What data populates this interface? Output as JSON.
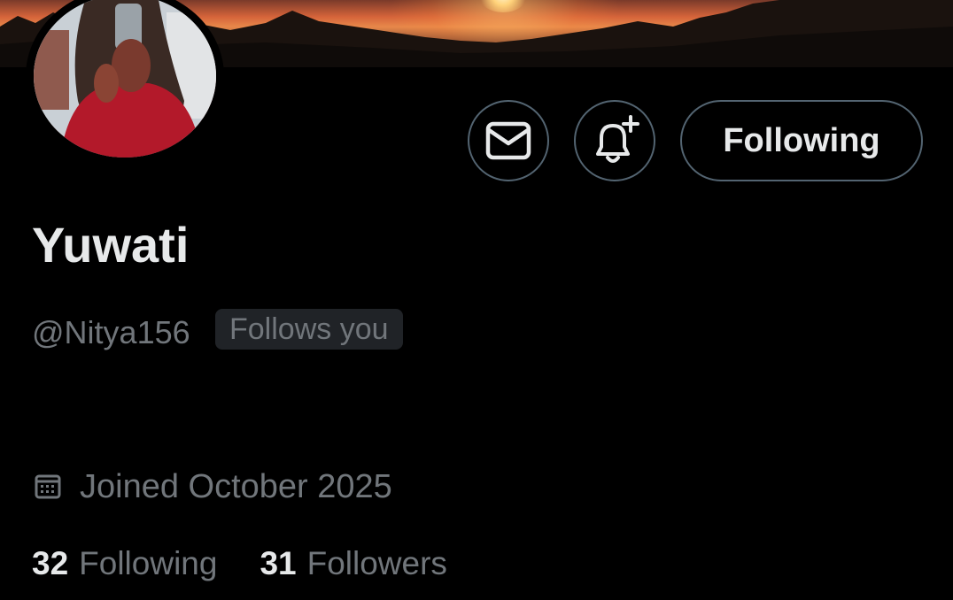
{
  "profile": {
    "display_name": "Yuwati",
    "handle": "@Nitya156",
    "follows_you_badge": "Follows you",
    "joined": "Joined October 2025"
  },
  "actions": {
    "follow_state_label": "Following"
  },
  "stats": {
    "following_count": "32",
    "following_label": "Following",
    "followers_count": "31",
    "followers_label": "Followers"
  },
  "icons": {
    "message": "mail-icon",
    "notify": "bell-plus-icon",
    "joined": "calendar-icon"
  },
  "colors": {
    "background": "#000000",
    "primary_text": "#e7e9ea",
    "secondary_text": "#71767b",
    "button_border": "#536471",
    "badge_bg": "#202327"
  }
}
